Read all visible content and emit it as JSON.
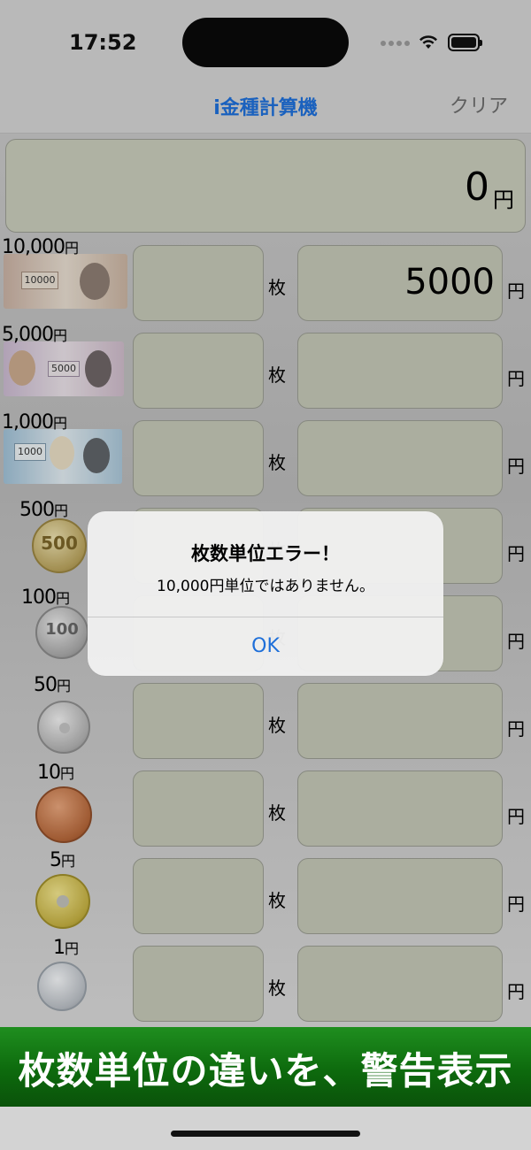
{
  "status": {
    "time": "17:52"
  },
  "nav": {
    "title": "i金種計算機",
    "clear_label": "クリア"
  },
  "total": {
    "value": "0",
    "unit": "円"
  },
  "rows": [
    {
      "denomination": "10,000",
      "unit_small": "円",
      "count": "",
      "count_unit": "枚",
      "amount": "5000",
      "amount_unit": "円",
      "kind": "note",
      "note_color": "#b79a88"
    },
    {
      "denomination": "5,000",
      "unit_small": "円",
      "count": "",
      "count_unit": "枚",
      "amount": "",
      "amount_unit": "円",
      "kind": "note",
      "note_color": "#b9a6c0"
    },
    {
      "denomination": "1,000",
      "unit_small": "円",
      "count": "",
      "count_unit": "枚",
      "amount": "",
      "amount_unit": "円",
      "kind": "note",
      "note_color": "#8fb5cf"
    },
    {
      "denomination": "500",
      "unit_small": "円",
      "count": "",
      "count_unit": "枚",
      "amount": "",
      "amount_unit": "円",
      "kind": "coin",
      "coin_color": "#c9b674"
    },
    {
      "denomination": "100",
      "unit_small": "円",
      "count": "",
      "count_unit": "枚",
      "amount": "",
      "amount_unit": "円",
      "kind": "coin",
      "coin_color": "#b5b5b5"
    },
    {
      "denomination": "50",
      "unit_small": "円",
      "count": "",
      "count_unit": "枚",
      "amount": "",
      "amount_unit": "円",
      "kind": "coin",
      "coin_color": "#bdbdbd"
    },
    {
      "denomination": "10",
      "unit_small": "円",
      "count": "",
      "count_unit": "枚",
      "amount": "",
      "amount_unit": "円",
      "kind": "coin",
      "coin_color": "#b8683c"
    },
    {
      "denomination": "5",
      "unit_small": "円",
      "count": "",
      "count_unit": "枚",
      "amount": "",
      "amount_unit": "円",
      "kind": "coin",
      "coin_color": "#c6b44a"
    },
    {
      "denomination": "1",
      "unit_small": "円",
      "count": "",
      "count_unit": "枚",
      "amount": "",
      "amount_unit": "円",
      "kind": "coin",
      "coin_color": "#c4c8cc"
    }
  ],
  "alert": {
    "title": "枚数単位エラー！",
    "message": "10,000円単位ではありません。",
    "ok_label": "OK"
  },
  "banner": {
    "text": "枚数単位の違いを、警告表示"
  },
  "colors": {
    "accent": "#1e6fd9",
    "banner": "#0d6a0d"
  }
}
